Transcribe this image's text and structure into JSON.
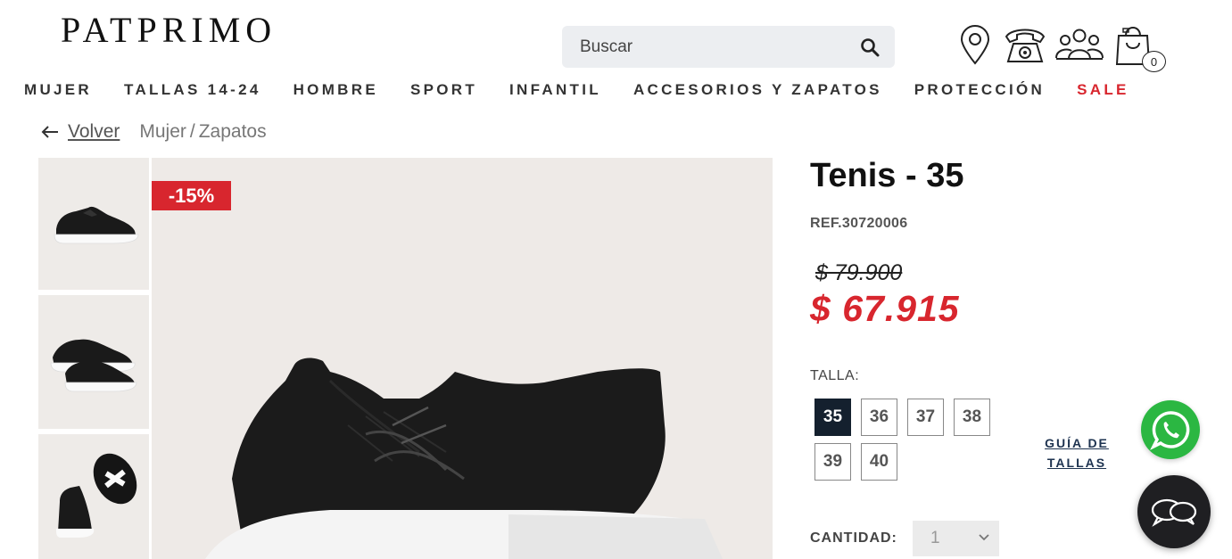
{
  "header": {
    "logo": "PATPRIMO",
    "search_placeholder": "Buscar",
    "cart_count": "0",
    "icons": [
      "location-pin-icon",
      "phone-icon",
      "people-icon",
      "shopping-bag-icon",
      "search-icon"
    ]
  },
  "nav": {
    "items": [
      "MUJER",
      "TALLAS 14-24",
      "HOMBRE",
      "SPORT",
      "INFANTIL",
      "ACCESORIOS Y ZAPATOS",
      "PROTECCIÓN",
      "SALE"
    ],
    "sale_color": "#d8262e"
  },
  "breadcrumb": {
    "back_label": "Volver",
    "section": "Mujer",
    "separator": "/",
    "category": "Zapatos"
  },
  "product": {
    "discount_badge": "-15%",
    "title": "Tenis - 35",
    "ref": "REF.30720006",
    "old_price": "$ 79.900",
    "price": "$ 67.915",
    "price_color": "#d8262e",
    "size_label": "TALLA:",
    "sizes": [
      "35",
      "36",
      "37",
      "38",
      "39",
      "40"
    ],
    "selected_size": "35",
    "size_guide_line1": "GUÍA DE",
    "size_guide_line2": "TALLAS",
    "quantity_label": "CANTIDAD:",
    "quantity_value": "1"
  },
  "floating": {
    "whatsapp_icon": "whatsapp-icon",
    "chat_icon": "chat-bubbles-icon"
  }
}
